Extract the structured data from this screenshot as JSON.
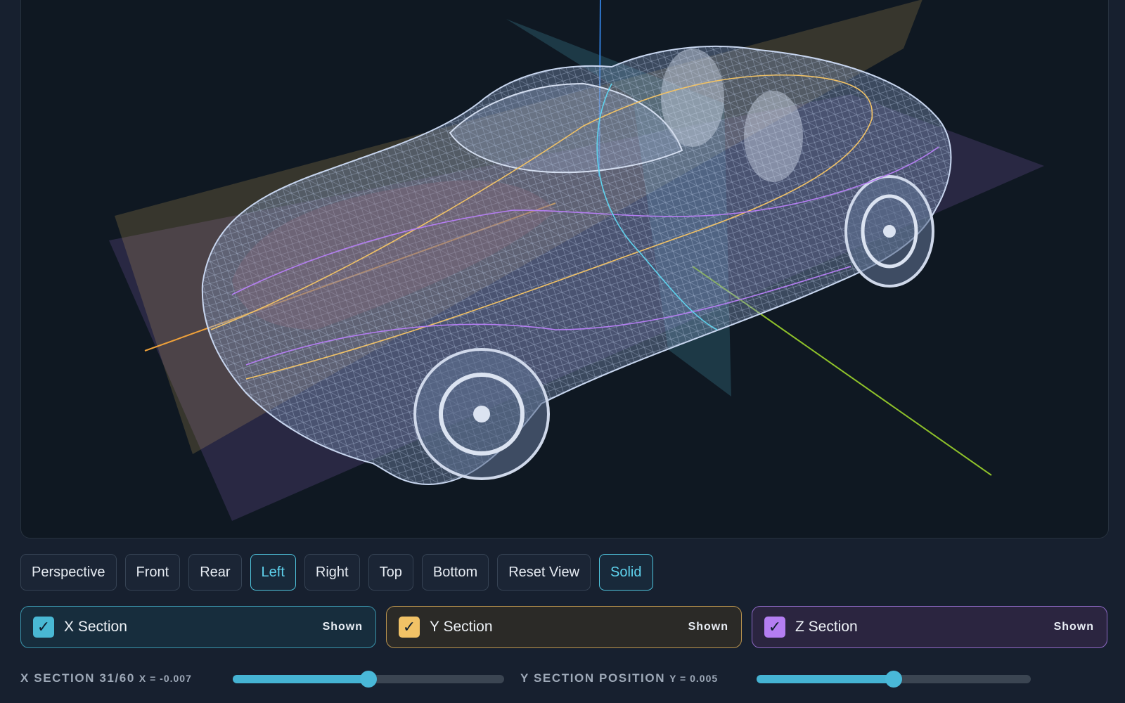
{
  "viewport": {
    "model_icon": "wireframe-car-model",
    "colors": {
      "background": "#0f1822",
      "x_plane": "#5fd3ee",
      "y_plane": "#f1c266",
      "z_plane": "#b47ef2",
      "mesh": "#b8c9e6"
    }
  },
  "toolbar": {
    "buttons": [
      {
        "label": "Perspective",
        "active": false
      },
      {
        "label": "Front",
        "active": false
      },
      {
        "label": "Rear",
        "active": false
      },
      {
        "label": "Left",
        "active": true
      },
      {
        "label": "Right",
        "active": false
      },
      {
        "label": "Top",
        "active": false
      },
      {
        "label": "Bottom",
        "active": false
      },
      {
        "label": "Reset View",
        "active": false
      },
      {
        "label": "Solid",
        "active": true
      }
    ]
  },
  "sections": [
    {
      "label": "X Section",
      "state": "Shown",
      "checked": true,
      "check_icon": "check-icon",
      "color": "#49b8d4"
    },
    {
      "label": "Y Section",
      "state": "Shown",
      "checked": true,
      "check_icon": "check-icon",
      "color": "#f1c266"
    },
    {
      "label": "Z Section",
      "state": "Shown",
      "checked": true,
      "check_icon": "check-icon",
      "color": "#b47ef2"
    }
  ],
  "sliders": {
    "x": {
      "title": "X SECTION 31/60",
      "value_text": "X = -0.007",
      "fraction": 0.5
    },
    "y": {
      "title": "Y SECTION POSITION",
      "value_text": "Y = 0.005",
      "fraction": 0.5
    }
  },
  "check_glyph": "✓"
}
